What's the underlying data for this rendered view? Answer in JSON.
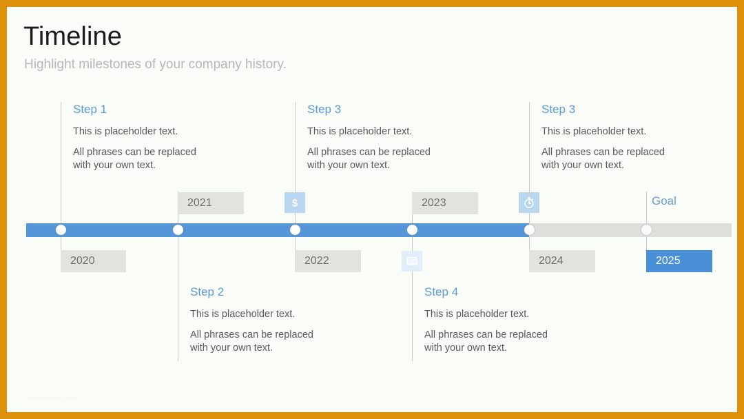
{
  "slide": {
    "title": "Timeline",
    "subtitle": "Highlight milestones of your company history.",
    "watermark": "slidemodel.com",
    "border_color": "#DD9009",
    "background_color": "#F9FCF7"
  },
  "timeline": {
    "track_color": "#DEDFDA",
    "progress_color": "#5596D8",
    "accent_color": "#4A90D9",
    "step_title_color": "#5B9BD5",
    "progress_end_year": "2024",
    "markers": [
      {
        "year": "2020",
        "position": "above_bar_text_below",
        "dot": "filled"
      },
      {
        "year": "2021",
        "position": "below_bar_text_above",
        "dot": "filled"
      },
      {
        "year": "2022",
        "position": "above_bar_text_below",
        "dot": "filled"
      },
      {
        "year": "2023",
        "position": "below_bar_text_above",
        "dot": "filled"
      },
      {
        "year": "2024",
        "position": "above_bar_text_below",
        "dot": "filled"
      },
      {
        "year": "2025",
        "position": "above_bar_text_below",
        "dot": "muted",
        "highlighted": true
      }
    ],
    "goal_label": "Goal",
    "icons": [
      {
        "name": "dollar-icon",
        "glyph": "$",
        "placement": "above_bar"
      },
      {
        "name": "stopwatch-icon",
        "glyph": "timer",
        "placement": "above_bar"
      },
      {
        "name": "laptop-icon",
        "glyph": "laptop",
        "placement": "below_bar"
      }
    ]
  },
  "steps": {
    "top": [
      {
        "title": "Step 1",
        "line1": "This is placeholder  text.",
        "line2": "All phrases can be replaced",
        "line3": "with your own text."
      },
      {
        "title": "Step 3",
        "line1": "This is placeholder  text.",
        "line2": "All phrases can be replaced",
        "line3": "with your own text."
      },
      {
        "title": "Step 3",
        "line1": "This is placeholder  text.",
        "line2": "All phrases can be replaced",
        "line3": "with your own text."
      }
    ],
    "bottom": [
      {
        "title": "Step 2",
        "line1": "This is placeholder  text.",
        "line2": "All phrases can be replaced",
        "line3": "with your own text."
      },
      {
        "title": "Step 4",
        "line1": "This is placeholder  text.",
        "line2": "All phrases can be replaced",
        "line3": "with your own text."
      }
    ]
  }
}
